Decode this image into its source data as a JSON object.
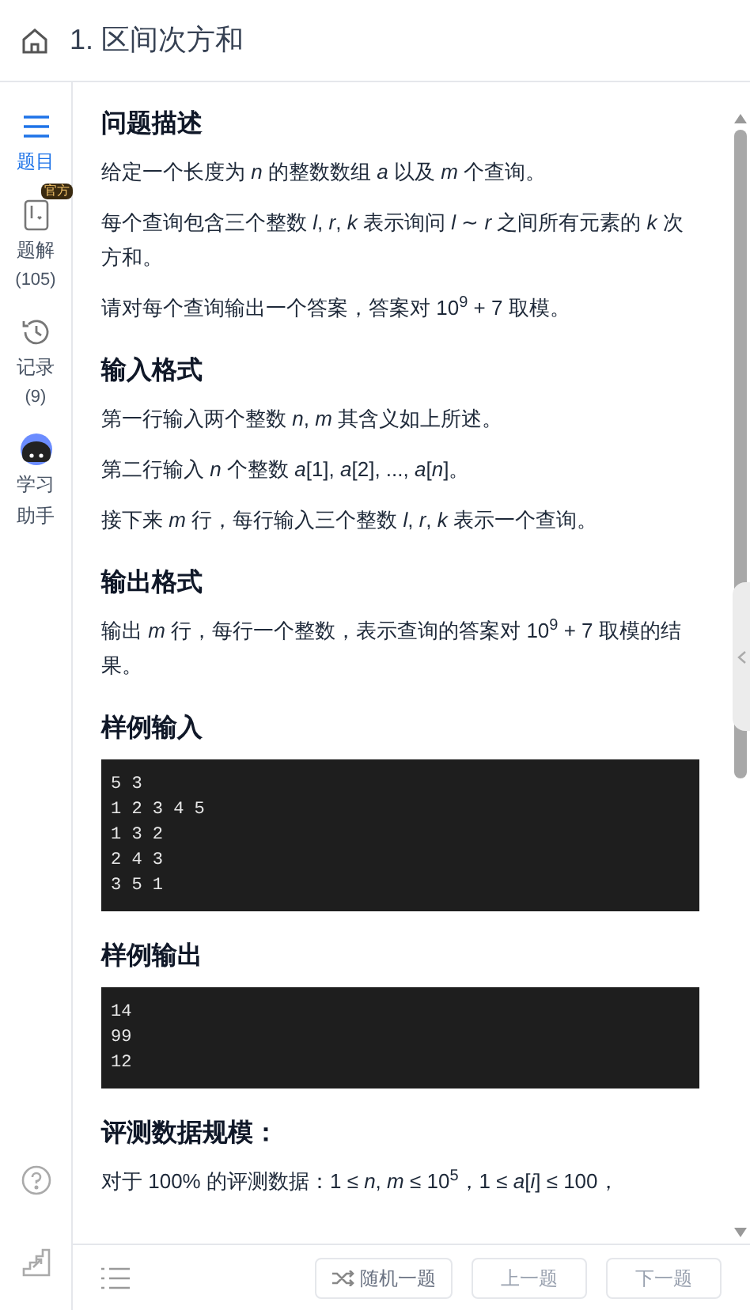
{
  "header": {
    "title": "1. 区间次方和"
  },
  "sidebar": {
    "items": [
      {
        "kind": "list",
        "label": "题目",
        "selected": true
      },
      {
        "kind": "solution",
        "label": "题解",
        "badge": "官方",
        "count": "(105)",
        "selected": false
      },
      {
        "kind": "history",
        "label": "记录",
        "count": "(9)",
        "selected": false
      },
      {
        "kind": "assistant",
        "label": "学习助手",
        "selected": false
      }
    ]
  },
  "sections": [
    {
      "heading": "问题描述",
      "paragraphs": [
        "给定一个长度为 *n* 的整数数组 *a* 以及 *m* 个查询。",
        "每个查询包含三个整数 *l*, *r*, *k* 表示询问 *l* ∼ *r* 之间所有元素的 *k* 次方和。",
        "请对每个查询输出一个答案，答案对 10$^{9}$ + 7 取模。"
      ]
    },
    {
      "heading": "输入格式",
      "paragraphs": [
        "第一行输入两个整数 *n*, *m* 其含义如上所述。",
        "第二行输入 *n* 个整数 *a*[1], *a*[2], ..., *a*[*n*]。",
        "接下来 *m* 行，每行输入三个整数 *l*, *r*, *k* 表示一个查询。"
      ]
    },
    {
      "heading": "输出格式",
      "paragraphs": [
        "输出 *m* 行，每行一个整数，表示查询的答案对 10$^{9}$ + 7 取模的结果。"
      ]
    },
    {
      "heading": "样例输入",
      "code": [
        "5 3",
        "1 2 3 4 5",
        "1 3 2",
        "2 4 3",
        "3 5 1"
      ]
    },
    {
      "heading": "样例输出",
      "code": [
        "14",
        "99",
        "12"
      ]
    },
    {
      "heading": "评测数据规模：",
      "paragraphs": [
        "对于 100% 的评测数据：1 ≤ *n*, *m* ≤ 10$^{5}$，1 ≤ *a*[*i*] ≤ 100，"
      ]
    }
  ],
  "footer": {
    "buttons": [
      {
        "kind": "random",
        "label": "随机一题"
      },
      {
        "kind": "plain",
        "label": "上一题"
      },
      {
        "kind": "plain",
        "label": "下一题"
      }
    ]
  }
}
